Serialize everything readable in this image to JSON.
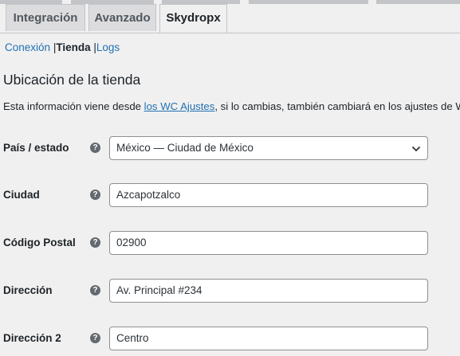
{
  "tabs": [
    {
      "label": "Integración"
    },
    {
      "label": "Avanzado"
    },
    {
      "label": "Skydropx"
    }
  ],
  "subnav": [
    {
      "label": "Conexión"
    },
    {
      "label": "Tienda"
    },
    {
      "label": "Logs"
    }
  ],
  "section": {
    "title": "Ubicación de la tienda",
    "description_before": "Esta información viene desde ",
    "description_link": "los WC Ajustes",
    "description_after": ", si lo cambias, también cambiará en los ajustes de WC."
  },
  "fields": [
    {
      "label": "País / estado",
      "value": "México — Ciudad de México"
    },
    {
      "label": "Ciudad",
      "value": "Azcapotzalco"
    },
    {
      "label": "Código Postal",
      "value": "02900"
    },
    {
      "label": "Dirección",
      "value": "Av. Principal #234"
    },
    {
      "label": "Dirección 2",
      "value": "Centro"
    }
  ],
  "help_glyph": "?"
}
